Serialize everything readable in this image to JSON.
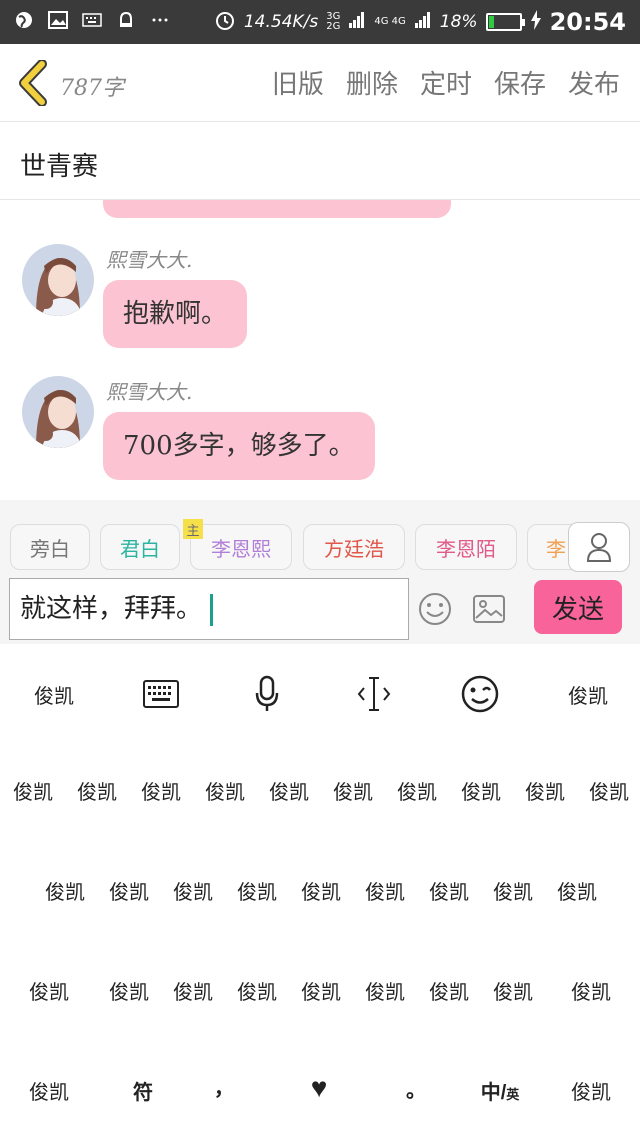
{
  "status_bar": {
    "speed": "14.54K/s",
    "net_3g": "3G",
    "net_2g": "2G",
    "net_4g": "4G 4G",
    "battery_pct": "18%",
    "battery_level": 0.18,
    "time": "20:54"
  },
  "top_bar": {
    "word_count": "787字",
    "actions": [
      "旧版",
      "删除",
      "定时",
      "保存",
      "发布"
    ]
  },
  "title": "世青赛",
  "messages": [
    {
      "sender": "熙雪大大.",
      "text": "抱歉啊。"
    },
    {
      "sender": "熙雪大大.",
      "text": "700多字，够多了。"
    }
  ],
  "roles": {
    "main_tag": "主",
    "chips": [
      {
        "label": "旁白",
        "color": "#777777"
      },
      {
        "label": "君白",
        "color": "#2bb5a0"
      },
      {
        "label": "李恩熙",
        "color": "#b27fd8"
      },
      {
        "label": "方廷浩",
        "color": "#e0564a"
      },
      {
        "label": "李恩陌",
        "color": "#e05a8a"
      },
      {
        "label": "李",
        "color": "#f0a050"
      }
    ]
  },
  "input": {
    "value": "就这样，拜拜。",
    "send_label": "发送"
  },
  "keyboard": {
    "toolbar_left": "俊凯",
    "toolbar_right": "俊凯",
    "row1": [
      "俊凯",
      "俊凯",
      "俊凯",
      "俊凯",
      "俊凯",
      "俊凯",
      "俊凯",
      "俊凯",
      "俊凯",
      "俊凯"
    ],
    "row2": [
      "俊凯",
      "俊凯",
      "俊凯",
      "俊凯",
      "俊凯",
      "俊凯",
      "俊凯",
      "俊凯",
      "俊凯"
    ],
    "row3": [
      "俊凯",
      "俊凯",
      "俊凯",
      "俊凯",
      "俊凯",
      "俊凯",
      "俊凯",
      "俊凯",
      "俊凯"
    ],
    "row4": {
      "left": "俊凯",
      "symbols": "符",
      "comma": "，",
      "heart": "♥",
      "period": "。",
      "lang_main": "中/",
      "lang_sub": "英",
      "right": "俊凯"
    }
  }
}
